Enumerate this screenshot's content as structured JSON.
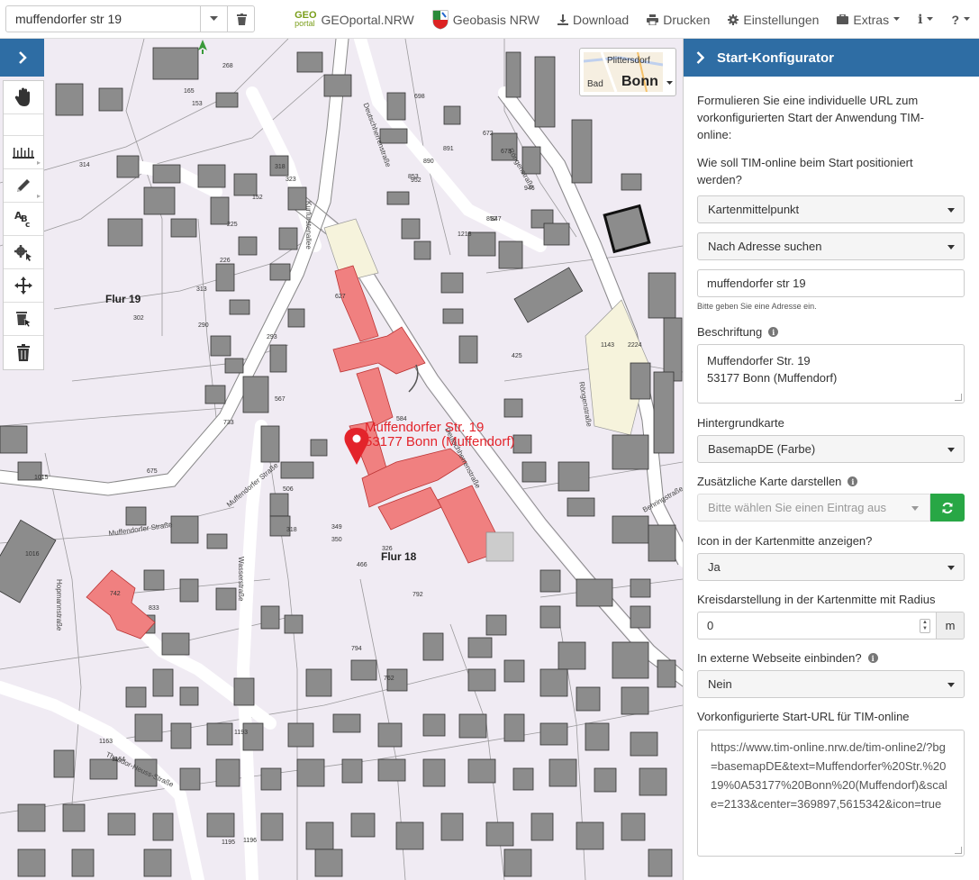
{
  "search": {
    "value": "muffendorfer str 19"
  },
  "nav": {
    "geoportal_logo_top": "GEO",
    "geoportal_logo_bottom": "portal",
    "geoportal": "GEOportal.NRW",
    "geobasis": "Geobasis NRW",
    "download": "Download",
    "drucken": "Drucken",
    "einstellungen": "Einstellungen",
    "extras": "Extras",
    "info": "i",
    "help": "?"
  },
  "map": {
    "flur19": "Flur 19",
    "flur18": "Flur 18",
    "marker_line1": "Muffendorfer Str. 19",
    "marker_line2": "53177 Bonn (Muffendorf)",
    "overview_small": "Plittersdorf",
    "overview_bad": "Bad",
    "overview_big": "Bonn",
    "street_labels": [
      "Muffendorfer Straße",
      "Muffendorfer Straße",
      "Kurfürstenallee",
      "Deutschherrenstraße",
      "Röngenstraße",
      "Wasserstraße",
      "Hopmannstraße",
      "Deutschherrenstraße",
      "Röngenstraße",
      "Behringstraße",
      "Theodor-Heuss-Straße"
    ],
    "parcel_numbers": [
      "806",
      "704",
      "698",
      "672",
      "890",
      "891",
      "673",
      "952",
      "853",
      "852",
      "946",
      "847",
      "1218",
      "1143",
      "2224",
      "268",
      "165",
      "153",
      "314",
      "318",
      "323",
      "152",
      "225",
      "226",
      "313",
      "302",
      "290",
      "293",
      "627",
      "584",
      "567",
      "733",
      "675",
      "1015",
      "1016",
      "742",
      "833",
      "792",
      "794",
      "762",
      "1195",
      "1196",
      "1193",
      "1163",
      "1164",
      "425",
      "349",
      "350",
      "466",
      "318",
      "506",
      "326"
    ]
  },
  "panel": {
    "title": "Start-Konfigurator",
    "intro": "Formulieren Sie eine individuelle URL zum vorkonfigurierten Start der Anwendung TIM-online:",
    "q_position": "Wie soll TIM-online beim Start positioniert werden?",
    "position_select": "Kartenmittelpunkt",
    "method_select": "Nach Adresse suchen",
    "address_value": "muffendorfer str 19",
    "address_help": "Bitte geben Sie eine Adresse ein.",
    "beschriftung_label": "Beschriftung",
    "beschriftung_line1": "Muffendorfer Str. 19",
    "beschriftung_line2": "53177 Bonn (Muffendorf)",
    "hintergrund_label": "Hintergrundkarte",
    "hintergrund_select": "BasemapDE (Farbe)",
    "zusatz_label": "Zusätzliche Karte darstellen",
    "zusatz_placeholder": "Bitte wählen Sie einen Eintrag aus",
    "icon_label": "Icon in der Kartenmitte anzeigen?",
    "icon_select": "Ja",
    "kreis_label": "Kreisdarstellung in der Kartenmitte mit Radius",
    "kreis_value": "0",
    "kreis_unit": "m",
    "extern_label": "In externe Webseite einbinden?",
    "extern_select": "Nein",
    "url_label": "Vorkonfigurierte Start-URL für TIM-online",
    "url_value": "https://www.tim-online.nrw.de/tim-online2/?bg=basemapDE&text=Muffendorfer%20Str.%2019%0A53177%20Bonn%20(Muffendorf)&scale=2133&center=369897,5615342&icon=true"
  },
  "colors": {
    "accent": "#2e6da4",
    "success": "#28a745",
    "marker": "#e3242b",
    "building_highlight": "#f08080"
  }
}
